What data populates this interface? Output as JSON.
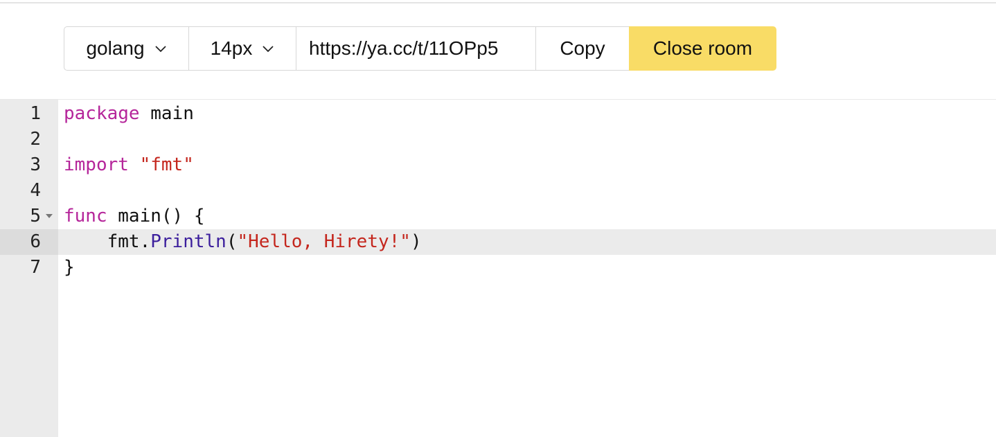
{
  "toolbar": {
    "language": "golang",
    "font_size": "14px",
    "room_url": "https://ya.cc/t/11OPp5",
    "copy_label": "Copy",
    "close_label": "Close room"
  },
  "editor": {
    "active_line": 6,
    "lines": [
      {
        "num": "1",
        "kw": "package",
        "rest": " main"
      },
      {
        "num": "2"
      },
      {
        "num": "3",
        "kw": "import",
        "sp": " ",
        "str": "\"fmt\""
      },
      {
        "num": "4"
      },
      {
        "num": "5",
        "kw": "func",
        "rest": " main() {"
      },
      {
        "num": "6",
        "indent": "    ",
        "obj": "fmt.",
        "fn": "Println",
        "open": "(",
        "str": "\"Hello, Hirety!\"",
        "close": ")"
      },
      {
        "num": "7",
        "rest": "}"
      }
    ]
  },
  "colors": {
    "keyword": "#b5259a",
    "string": "#c4261d",
    "function": "#3b1e9c",
    "close_button": "#f9dc66",
    "gutter": "#ebebeb"
  }
}
